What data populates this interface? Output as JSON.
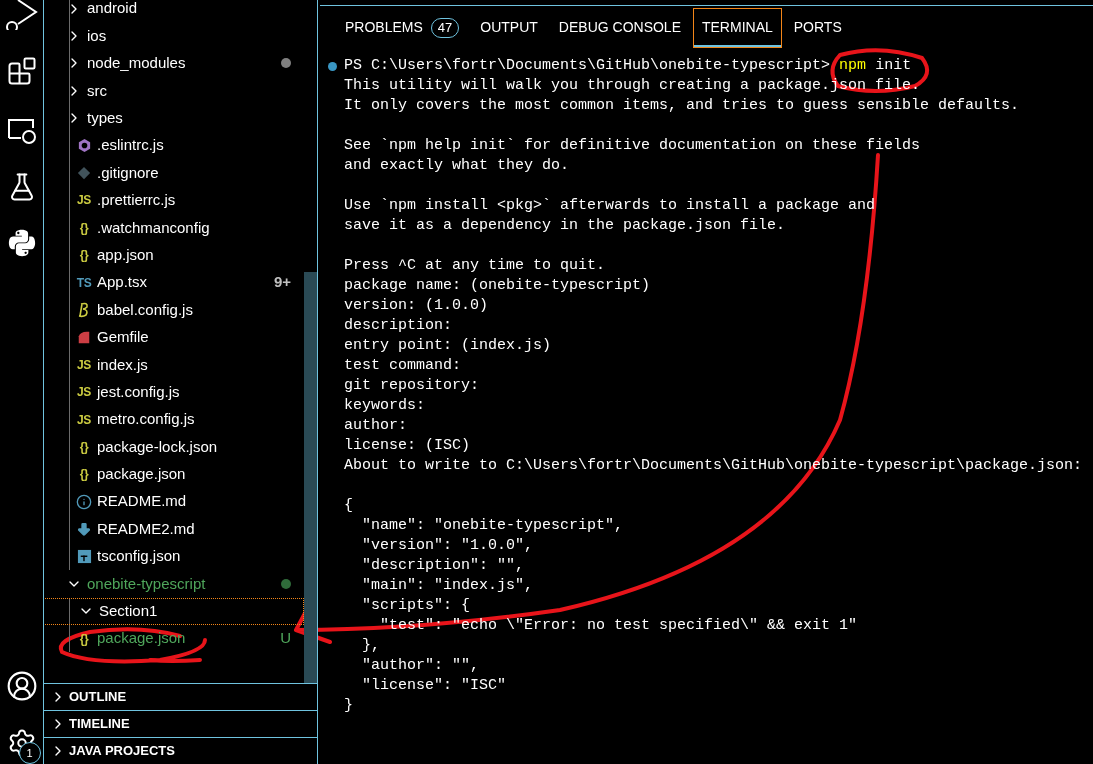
{
  "activity_bar": {
    "settings_badge": "1"
  },
  "explorer": {
    "tree": [
      {
        "children": [
          {
            "label": "android",
            "kind": "folder",
            "expanded": false,
            "untracked": false
          },
          {
            "label": "ios",
            "kind": "folder",
            "expanded": false,
            "untracked": false
          },
          {
            "label": "node_modules",
            "kind": "folder",
            "expanded": false,
            "untracked": false,
            "dot": true
          },
          {
            "label": "src",
            "kind": "folder",
            "expanded": false,
            "untracked": false
          },
          {
            "label": "types",
            "kind": "folder",
            "expanded": false,
            "untracked": false
          },
          {
            "label": ".eslintrc.js",
            "kind": "file",
            "icon": {
              "kind": "eslint",
              "color": "#a074c4"
            },
            "untracked": false
          },
          {
            "label": ".gitignore",
            "kind": "file",
            "icon": {
              "kind": "git",
              "color": "#41535b"
            },
            "untracked": false
          },
          {
            "label": ".prettierrc.js",
            "kind": "file",
            "icon": {
              "kind": "glyph",
              "text": "JS",
              "color": "#cbcb41"
            },
            "untracked": false
          },
          {
            "label": ".watchmanconfig",
            "kind": "file",
            "icon": {
              "kind": "glyph",
              "text": "{}",
              "color": "#cbcb41"
            },
            "untracked": false
          },
          {
            "label": "app.json",
            "kind": "file",
            "icon": {
              "kind": "glyph",
              "text": "{}",
              "color": "#cbcb41"
            },
            "untracked": false
          },
          {
            "label": "App.tsx",
            "kind": "file",
            "icon": {
              "kind": "glyph",
              "text": "TS",
              "color": "#519aba"
            },
            "untracked": false,
            "badge": "9+"
          },
          {
            "label": "babel.config.js",
            "kind": "file",
            "icon": {
              "kind": "babel",
              "color": "#cbcb41"
            },
            "untracked": false
          },
          {
            "label": "Gemfile",
            "kind": "file",
            "icon": {
              "kind": "ruby",
              "color": "#cc3e44"
            },
            "untracked": false
          },
          {
            "label": "index.js",
            "kind": "file",
            "icon": {
              "kind": "glyph",
              "text": "JS",
              "color": "#cbcb41"
            },
            "untracked": false
          },
          {
            "label": "jest.config.js",
            "kind": "file",
            "icon": {
              "kind": "glyph",
              "text": "JS",
              "color": "#cbcb41"
            },
            "untracked": false
          },
          {
            "label": "metro.config.js",
            "kind": "file",
            "icon": {
              "kind": "glyph",
              "text": "JS",
              "color": "#cbcb41"
            },
            "untracked": false
          },
          {
            "label": "package-lock.json",
            "kind": "file",
            "icon": {
              "kind": "glyph",
              "text": "{}",
              "color": "#cbcb41"
            },
            "untracked": false
          },
          {
            "label": "package.json",
            "kind": "file",
            "icon": {
              "kind": "glyph",
              "text": "{}",
              "color": "#cbcb41"
            },
            "untracked": false
          },
          {
            "label": "README.md",
            "kind": "file",
            "icon": {
              "kind": "info",
              "color": "#519aba"
            },
            "untracked": false
          },
          {
            "label": "README2.md",
            "kind": "file",
            "icon": {
              "kind": "download",
              "color": "#519aba"
            },
            "untracked": false
          },
          {
            "label": "tsconfig.json",
            "kind": "file",
            "icon": {
              "kind": "tsconfig",
              "color": "#519aba"
            },
            "untracked": false
          }
        ]
      },
      {
        "label": "onebite-typescript",
        "kind": "folder",
        "expanded": true,
        "untracked": true,
        "dot": true,
        "children": [
          {
            "label": "Section1",
            "kind": "folder",
            "expanded": true,
            "untracked": false,
            "focused": true,
            "children": [
              {
                "label": "package.json",
                "kind": "file",
                "icon": {
                  "kind": "glyph",
                  "text": "{}",
                  "color": "#cbcb41"
                },
                "untracked": true,
                "badge": "U"
              }
            ]
          }
        ]
      }
    ],
    "sections": [
      {
        "label": "OUTLINE",
        "expanded": false
      },
      {
        "label": "TIMELINE",
        "expanded": false
      },
      {
        "label": "JAVA PROJECTS",
        "expanded": false
      }
    ]
  },
  "panel": {
    "tabs": [
      {
        "label": "PROBLEMS",
        "badge": "47",
        "selected": false
      },
      {
        "label": "OUTPUT",
        "selected": false
      },
      {
        "label": "DEBUG CONSOLE",
        "selected": false
      },
      {
        "label": "TERMINAL",
        "selected": true
      },
      {
        "label": "PORTS",
        "selected": false
      }
    ],
    "terminal": [
      {
        "kind": "prompt",
        "path": "PS C:\\Users\\fortr\\Documents\\GitHub\\onebite-typescript>",
        "command": "npm",
        "args": "init"
      },
      {
        "kind": "text",
        "text": "This utility will walk you through creating a package.json file."
      },
      {
        "kind": "text",
        "text": "It only covers the most common items, and tries to guess sensible defaults."
      },
      {
        "kind": "blank"
      },
      {
        "kind": "text",
        "text": "See `npm help init` for definitive documentation on these fields"
      },
      {
        "kind": "text",
        "text": "and exactly what they do."
      },
      {
        "kind": "blank"
      },
      {
        "kind": "text",
        "text": "Use `npm install <pkg>` afterwards to install a package and"
      },
      {
        "kind": "text",
        "text": "save it as a dependency in the package.json file."
      },
      {
        "kind": "blank"
      },
      {
        "kind": "text",
        "text": "Press ^C at any time to quit."
      },
      {
        "kind": "text",
        "text": "package name: (onebite-typescript)"
      },
      {
        "kind": "text",
        "text": "version: (1.0.0)"
      },
      {
        "kind": "text",
        "text": "description:"
      },
      {
        "kind": "text",
        "text": "entry point: (index.js)"
      },
      {
        "kind": "text",
        "text": "test command:"
      },
      {
        "kind": "text",
        "text": "git repository:"
      },
      {
        "kind": "text",
        "text": "keywords:"
      },
      {
        "kind": "text",
        "text": "author:"
      },
      {
        "kind": "text",
        "text": "license: (ISC)"
      },
      {
        "kind": "text",
        "text": "About to write to C:\\Users\\fortr\\Documents\\GitHub\\onebite-typescript\\package.json:"
      },
      {
        "kind": "blank"
      },
      {
        "kind": "text",
        "text": "{"
      },
      {
        "kind": "text",
        "text": "  \"name\": \"onebite-typescript\","
      },
      {
        "kind": "text",
        "text": "  \"version\": \"1.0.0\","
      },
      {
        "kind": "text",
        "text": "  \"description\": \"\","
      },
      {
        "kind": "text",
        "text": "  \"main\": \"index.js\","
      },
      {
        "kind": "text",
        "text": "  \"scripts\": {"
      },
      {
        "kind": "text",
        "text": "    \"test\": \"echo \\\"Error: no test specified\\\" && exit 1\""
      },
      {
        "kind": "text",
        "text": "  },"
      },
      {
        "kind": "text",
        "text": "  \"author\": \"\","
      },
      {
        "kind": "text",
        "text": "  \"license\": \"ISC\""
      },
      {
        "kind": "text",
        "text": "}"
      }
    ]
  }
}
